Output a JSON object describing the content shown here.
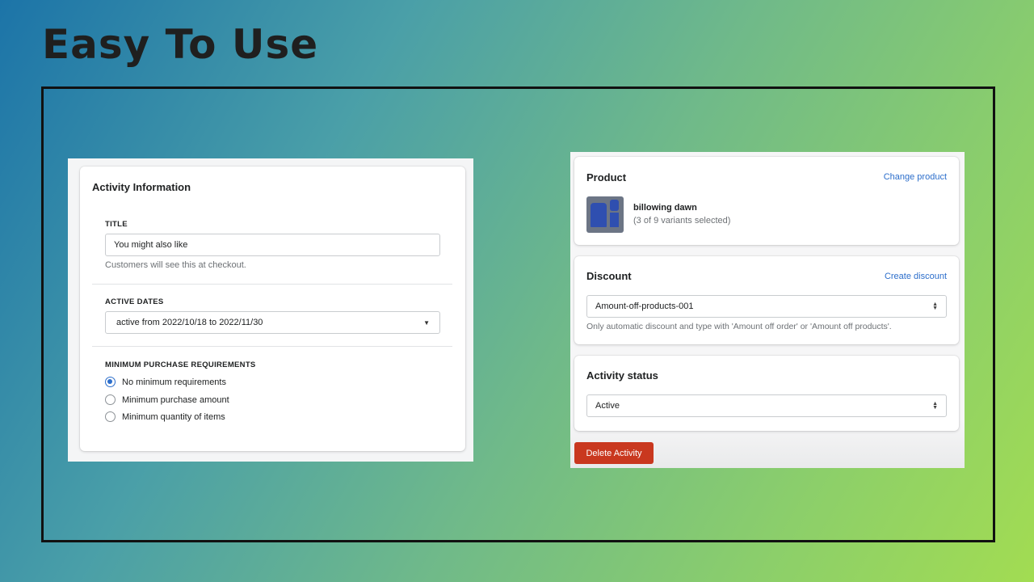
{
  "headline": "Easy To Use",
  "activity_info": {
    "heading": "Activity Information",
    "title_label": "TITLE",
    "title_value": "You might also like",
    "title_help": "Customers will see this at checkout.",
    "dates_label": "ACTIVE DATES",
    "dates_value": "active from 2022/10/18 to 2022/11/30",
    "min_label": "MINIMUM PURCHASE REQUIREMENTS",
    "options": [
      {
        "label": "No minimum requirements",
        "selected": true
      },
      {
        "label": "Minimum purchase amount",
        "selected": false
      },
      {
        "label": "Minimum quantity of items",
        "selected": false
      }
    ]
  },
  "product": {
    "heading": "Product",
    "link": "Change product",
    "name": "billowing dawn",
    "variants": "(3 of 9 variants selected)",
    "thumbnail_icon": "jersey-icon"
  },
  "discount": {
    "heading": "Discount",
    "link": "Create discount",
    "value": "Amount-off-products-001",
    "help": "Only automatic discount and type with 'Amount off order' or 'Amount off products'."
  },
  "status": {
    "heading": "Activity status",
    "value": "Active"
  },
  "delete_label": "Delete Activity",
  "colors": {
    "accent": "#2c6ecb",
    "danger": "#c9381f"
  }
}
